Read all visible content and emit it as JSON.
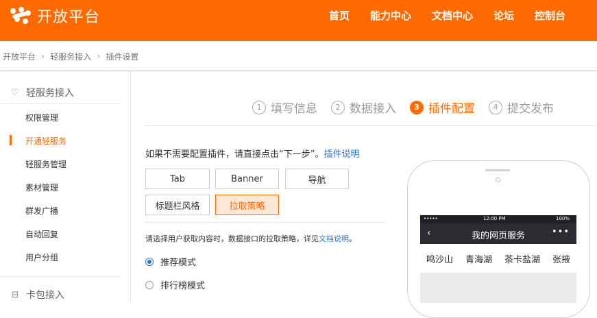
{
  "header": {
    "logo_text": "开放平台",
    "nav": [
      "首页",
      "能力中心",
      "文档中心",
      "论坛",
      "控制台"
    ],
    "brand_color": "#ff6a00"
  },
  "breadcrumb": [
    "开放平台",
    "轻服务接入",
    "插件设置"
  ],
  "sidebar": {
    "group1": {
      "label": "轻服务接入",
      "icon": "heart-icon"
    },
    "items": [
      "权限管理",
      "开通轻服务",
      "轻服务管理",
      "素材管理",
      "群发广播",
      "自动回复",
      "用户分组"
    ],
    "active_item": "开通轻服务",
    "group2": {
      "label": "卡包接入",
      "icon": "card-icon"
    }
  },
  "steps": [
    {
      "num": "1",
      "label": "填写信息"
    },
    {
      "num": "2",
      "label": "数据接入"
    },
    {
      "num": "3",
      "label": "插件配置",
      "active": true
    },
    {
      "num": "4",
      "label": "提交发布"
    }
  ],
  "intro": {
    "text": "如果不需要配置插件，请直接点击“下一步”。",
    "link": "插件说明"
  },
  "plugins": [
    "Tab",
    "Banner",
    "导航",
    "标题栏风格",
    "拉取策略"
  ],
  "active_plugin": "拉取策略",
  "strategy": {
    "desc": "请选择用户获取内容时，数据接口的拉取策略，详见",
    "link": "文档说明",
    "suffix": "。",
    "options": [
      "推荐模式",
      "排行榜模式"
    ],
    "selected": "推荐模式"
  },
  "phone": {
    "status": {
      "signal": "•••••",
      "time": "12:00 PM",
      "battery": "100%"
    },
    "back": "‹",
    "title": "我的网页服务",
    "more": "•••",
    "tabs": [
      "鸣沙山",
      "青海湖",
      "茶卡盐湖",
      "张掖"
    ]
  }
}
